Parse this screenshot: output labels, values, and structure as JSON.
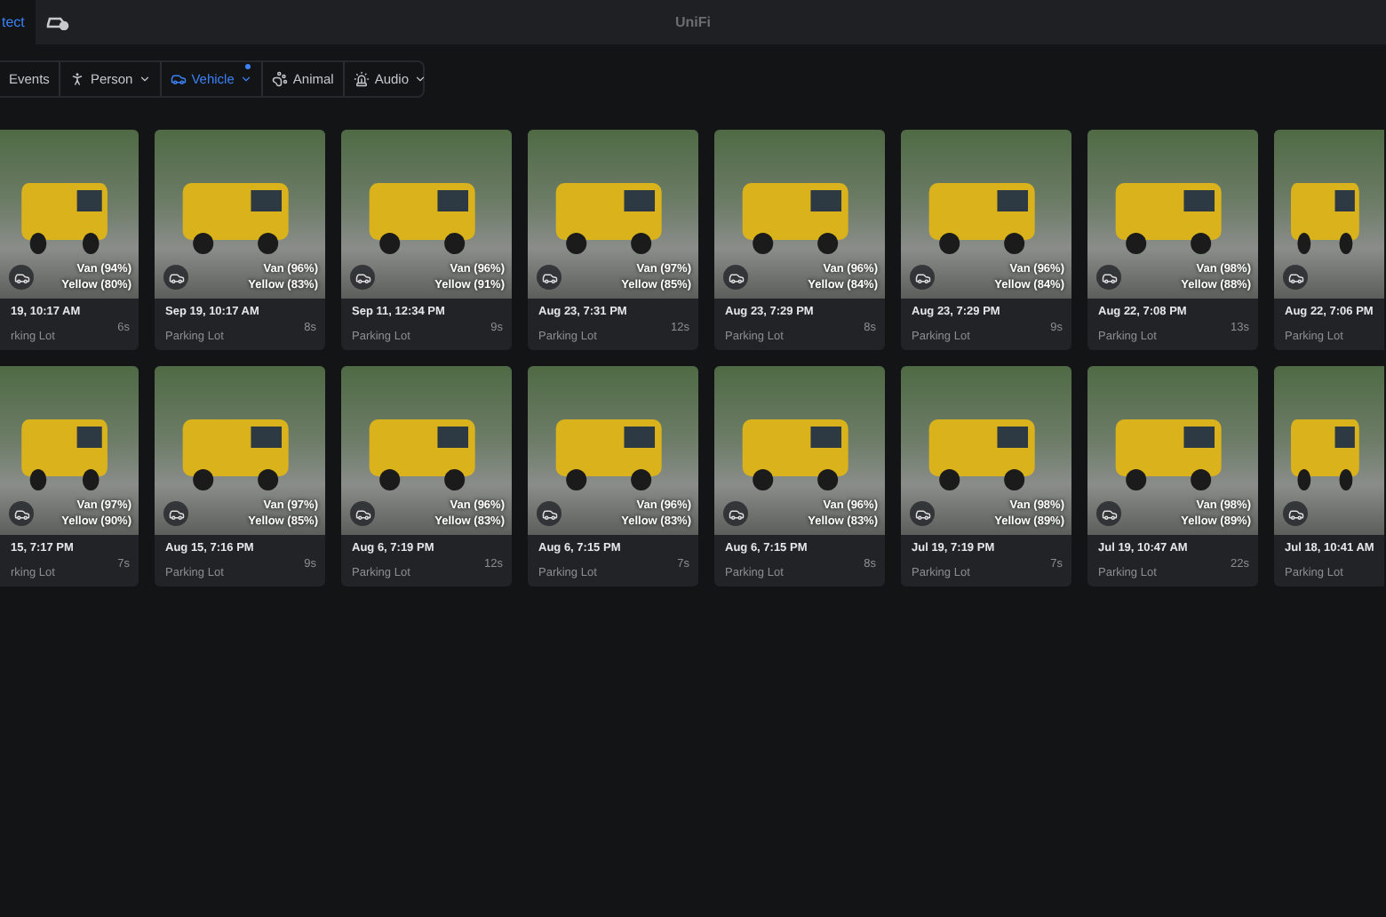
{
  "top_bar": {
    "tabs": [
      {
        "label": "tect",
        "selected": true
      }
    ],
    "title": "UniFi"
  },
  "filters": [
    {
      "label": "Events",
      "kind": "all",
      "menu": false,
      "selected": false,
      "dot": false
    },
    {
      "label": "Person",
      "kind": "person",
      "menu": true,
      "selected": false,
      "dot": false
    },
    {
      "label": "Vehicle",
      "kind": "vehicle",
      "menu": true,
      "selected": true,
      "dot": true
    },
    {
      "label": "Animal",
      "kind": "animal",
      "menu": false,
      "selected": false,
      "dot": false
    },
    {
      "label": "Audio",
      "kind": "audio",
      "menu": true,
      "selected": false,
      "dot": false
    }
  ],
  "rows": [
    [
      {
        "tags": [
          "Van (94%)",
          "Yellow (80%)"
        ],
        "date": "19, 10:17 AM",
        "location": "rking Lot",
        "duration": "6s"
      },
      {
        "tags": [
          "Van (96%)",
          "Yellow (83%)"
        ],
        "date": "Sep 19, 10:17 AM",
        "location": "Parking Lot",
        "duration": "8s"
      },
      {
        "tags": [
          "Van (96%)",
          "Yellow (91%)"
        ],
        "date": "Sep 11, 12:34 PM",
        "location": "Parking Lot",
        "duration": "9s"
      },
      {
        "tags": [
          "Van (97%)",
          "Yellow (85%)"
        ],
        "date": "Aug 23, 7:31 PM",
        "location": "Parking Lot",
        "duration": "12s"
      },
      {
        "tags": [
          "Van (96%)",
          "Yellow (84%)"
        ],
        "date": "Aug 23, 7:29 PM",
        "location": "Parking Lot",
        "duration": "8s"
      },
      {
        "tags": [
          "Van (96%)",
          "Yellow (84%)"
        ],
        "date": "Aug 23, 7:29 PM",
        "location": "Parking Lot",
        "duration": "9s"
      },
      {
        "tags": [
          "Van (98%)",
          "Yellow (88%)"
        ],
        "date": "Aug 22, 7:08 PM",
        "location": "Parking Lot",
        "duration": "13s"
      },
      {
        "date": "Aug 22, 7:06 PM",
        "location": "Parking Lot"
      }
    ],
    [
      {
        "tags": [
          "Van (97%)",
          "Yellow (90%)"
        ],
        "date": "15, 7:17 PM",
        "location": "rking Lot",
        "duration": "7s"
      },
      {
        "tags": [
          "Van (97%)",
          "Yellow (85%)"
        ],
        "date": "Aug 15, 7:16 PM",
        "location": "Parking Lot",
        "duration": "9s"
      },
      {
        "tags": [
          "Van (96%)",
          "Yellow (83%)"
        ],
        "date": "Aug 6, 7:19 PM",
        "location": "Parking Lot",
        "duration": "12s"
      },
      {
        "tags": [
          "Van (96%)",
          "Yellow (83%)"
        ],
        "date": "Aug 6, 7:15 PM",
        "location": "Parking Lot",
        "duration": "7s"
      },
      {
        "tags": [
          "Van (96%)",
          "Yellow (83%)"
        ],
        "date": "Aug 6, 7:15 PM",
        "location": "Parking Lot",
        "duration": "8s"
      },
      {
        "tags": [
          "Van (98%)",
          "Yellow (89%)"
        ],
        "date": "Jul 19, 7:19 PM",
        "location": "Parking Lot",
        "duration": "7s"
      },
      {
        "tags": [
          "Van (98%)",
          "Yellow (89%)"
        ],
        "date": "Jul 19, 10:47 AM",
        "location": "Parking Lot",
        "duration": "22s"
      },
      {
        "date": "Jul 18, 10:41 AM",
        "location": "Parking Lot"
      }
    ]
  ]
}
